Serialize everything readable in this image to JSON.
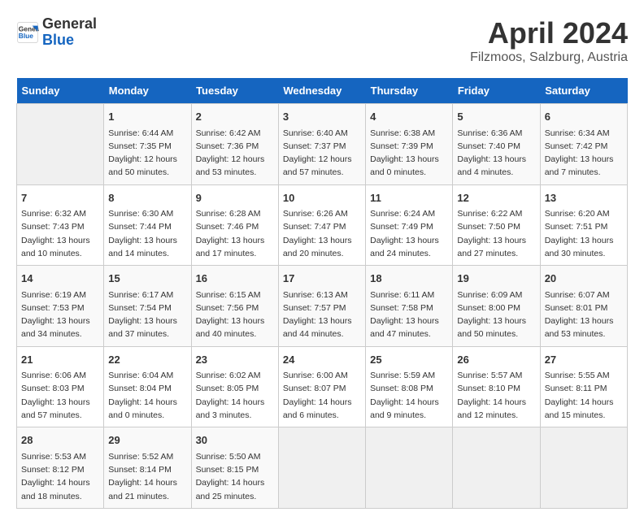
{
  "header": {
    "logo_line1": "General",
    "logo_line2": "Blue",
    "title": "April 2024",
    "subtitle": "Filzmoos, Salzburg, Austria"
  },
  "days_of_week": [
    "Sunday",
    "Monday",
    "Tuesday",
    "Wednesday",
    "Thursday",
    "Friday",
    "Saturday"
  ],
  "weeks": [
    [
      {
        "num": "",
        "info": ""
      },
      {
        "num": "1",
        "info": "Sunrise: 6:44 AM\nSunset: 7:35 PM\nDaylight: 12 hours\nand 50 minutes."
      },
      {
        "num": "2",
        "info": "Sunrise: 6:42 AM\nSunset: 7:36 PM\nDaylight: 12 hours\nand 53 minutes."
      },
      {
        "num": "3",
        "info": "Sunrise: 6:40 AM\nSunset: 7:37 PM\nDaylight: 12 hours\nand 57 minutes."
      },
      {
        "num": "4",
        "info": "Sunrise: 6:38 AM\nSunset: 7:39 PM\nDaylight: 13 hours\nand 0 minutes."
      },
      {
        "num": "5",
        "info": "Sunrise: 6:36 AM\nSunset: 7:40 PM\nDaylight: 13 hours\nand 4 minutes."
      },
      {
        "num": "6",
        "info": "Sunrise: 6:34 AM\nSunset: 7:42 PM\nDaylight: 13 hours\nand 7 minutes."
      }
    ],
    [
      {
        "num": "7",
        "info": "Sunrise: 6:32 AM\nSunset: 7:43 PM\nDaylight: 13 hours\nand 10 minutes."
      },
      {
        "num": "8",
        "info": "Sunrise: 6:30 AM\nSunset: 7:44 PM\nDaylight: 13 hours\nand 14 minutes."
      },
      {
        "num": "9",
        "info": "Sunrise: 6:28 AM\nSunset: 7:46 PM\nDaylight: 13 hours\nand 17 minutes."
      },
      {
        "num": "10",
        "info": "Sunrise: 6:26 AM\nSunset: 7:47 PM\nDaylight: 13 hours\nand 20 minutes."
      },
      {
        "num": "11",
        "info": "Sunrise: 6:24 AM\nSunset: 7:49 PM\nDaylight: 13 hours\nand 24 minutes."
      },
      {
        "num": "12",
        "info": "Sunrise: 6:22 AM\nSunset: 7:50 PM\nDaylight: 13 hours\nand 27 minutes."
      },
      {
        "num": "13",
        "info": "Sunrise: 6:20 AM\nSunset: 7:51 PM\nDaylight: 13 hours\nand 30 minutes."
      }
    ],
    [
      {
        "num": "14",
        "info": "Sunrise: 6:19 AM\nSunset: 7:53 PM\nDaylight: 13 hours\nand 34 minutes."
      },
      {
        "num": "15",
        "info": "Sunrise: 6:17 AM\nSunset: 7:54 PM\nDaylight: 13 hours\nand 37 minutes."
      },
      {
        "num": "16",
        "info": "Sunrise: 6:15 AM\nSunset: 7:56 PM\nDaylight: 13 hours\nand 40 minutes."
      },
      {
        "num": "17",
        "info": "Sunrise: 6:13 AM\nSunset: 7:57 PM\nDaylight: 13 hours\nand 44 minutes."
      },
      {
        "num": "18",
        "info": "Sunrise: 6:11 AM\nSunset: 7:58 PM\nDaylight: 13 hours\nand 47 minutes."
      },
      {
        "num": "19",
        "info": "Sunrise: 6:09 AM\nSunset: 8:00 PM\nDaylight: 13 hours\nand 50 minutes."
      },
      {
        "num": "20",
        "info": "Sunrise: 6:07 AM\nSunset: 8:01 PM\nDaylight: 13 hours\nand 53 minutes."
      }
    ],
    [
      {
        "num": "21",
        "info": "Sunrise: 6:06 AM\nSunset: 8:03 PM\nDaylight: 13 hours\nand 57 minutes."
      },
      {
        "num": "22",
        "info": "Sunrise: 6:04 AM\nSunset: 8:04 PM\nDaylight: 14 hours\nand 0 minutes."
      },
      {
        "num": "23",
        "info": "Sunrise: 6:02 AM\nSunset: 8:05 PM\nDaylight: 14 hours\nand 3 minutes."
      },
      {
        "num": "24",
        "info": "Sunrise: 6:00 AM\nSunset: 8:07 PM\nDaylight: 14 hours\nand 6 minutes."
      },
      {
        "num": "25",
        "info": "Sunrise: 5:59 AM\nSunset: 8:08 PM\nDaylight: 14 hours\nand 9 minutes."
      },
      {
        "num": "26",
        "info": "Sunrise: 5:57 AM\nSunset: 8:10 PM\nDaylight: 14 hours\nand 12 minutes."
      },
      {
        "num": "27",
        "info": "Sunrise: 5:55 AM\nSunset: 8:11 PM\nDaylight: 14 hours\nand 15 minutes."
      }
    ],
    [
      {
        "num": "28",
        "info": "Sunrise: 5:53 AM\nSunset: 8:12 PM\nDaylight: 14 hours\nand 18 minutes."
      },
      {
        "num": "29",
        "info": "Sunrise: 5:52 AM\nSunset: 8:14 PM\nDaylight: 14 hours\nand 21 minutes."
      },
      {
        "num": "30",
        "info": "Sunrise: 5:50 AM\nSunset: 8:15 PM\nDaylight: 14 hours\nand 25 minutes."
      },
      {
        "num": "",
        "info": ""
      },
      {
        "num": "",
        "info": ""
      },
      {
        "num": "",
        "info": ""
      },
      {
        "num": "",
        "info": ""
      }
    ]
  ]
}
